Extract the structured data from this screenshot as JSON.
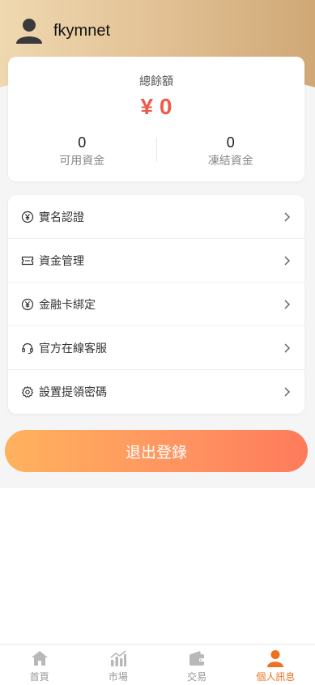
{
  "user": {
    "name": "fkymnet"
  },
  "balance": {
    "title": "總餘額",
    "amount": "¥ 0",
    "available_value": "0",
    "available_label": "可用資金",
    "frozen_value": "0",
    "frozen_label": "凍結資金"
  },
  "menu": [
    {
      "label": "實名認證",
      "icon": "yen-circle-icon"
    },
    {
      "label": "資金管理",
      "icon": "ticket-icon"
    },
    {
      "label": "金融卡綁定",
      "icon": "yen-circle-icon"
    },
    {
      "label": "官方在線客服",
      "icon": "headset-icon"
    },
    {
      "label": "設置提領密碼",
      "icon": "gear-icon"
    }
  ],
  "logout_label": "退出登錄",
  "tabs": [
    {
      "label": "首頁",
      "icon": "home-icon"
    },
    {
      "label": "市場",
      "icon": "chart-icon"
    },
    {
      "label": "交易",
      "icon": "wallet-icon"
    },
    {
      "label": "個人訊息",
      "icon": "person-icon"
    }
  ],
  "colors": {
    "accent": "#f15a4a",
    "active_tab": "#f07020",
    "header_gold": "#e2c195"
  }
}
